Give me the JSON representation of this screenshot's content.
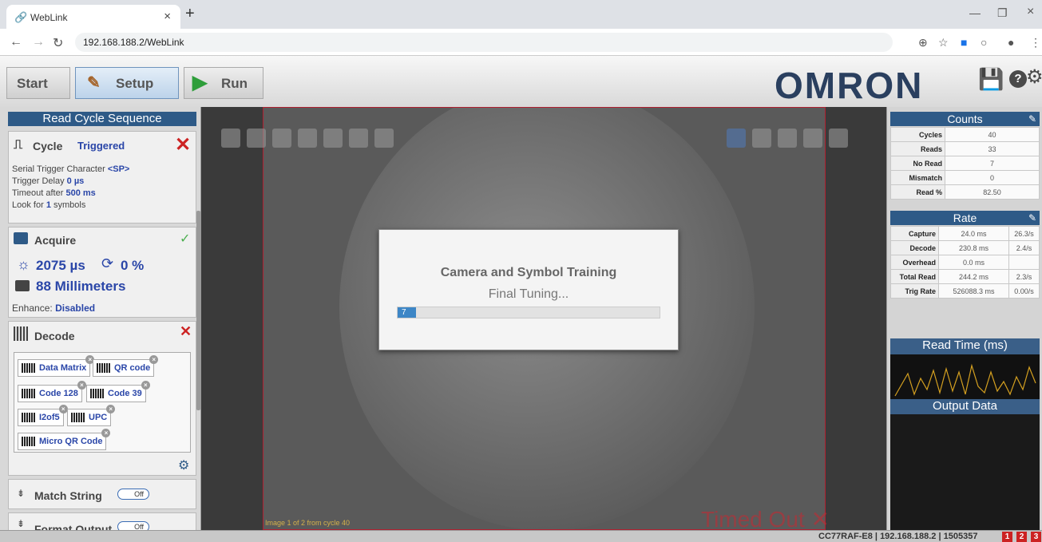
{
  "browser": {
    "tab_title": "WebLink",
    "url": "192.168.188.2/WebLink"
  },
  "app": {
    "steps": [
      "Start",
      "Setup",
      "Run"
    ],
    "logo": "OMRON"
  },
  "left_panel": {
    "title": "Read Cycle Sequence",
    "cycle": {
      "label": "Cycle",
      "mode": "Triggered",
      "lines": [
        {
          "pre": "Serial Trigger Character ",
          "val": "<SP>",
          "post": ""
        },
        {
          "pre": "Trigger Delay ",
          "val": "0 µs",
          "post": ""
        },
        {
          "pre": "Timeout after ",
          "val": "500 ms",
          "post": ""
        },
        {
          "pre": "Look for ",
          "val": "1",
          "post": " symbols"
        }
      ]
    },
    "acquire": {
      "label": "Acquire",
      "exposure": "2075 µs",
      "gain": "0 %",
      "distance": "88 Millimeters",
      "enhance_label": "Enhance:",
      "enhance_value": "Disabled"
    },
    "decode": {
      "label": "Decode",
      "symbologies": [
        "Data Matrix",
        "QR code",
        "Code 128",
        "Code 39",
        "I2of5",
        "UPC",
        "Micro QR Code"
      ]
    },
    "match_string": {
      "label": "Match String",
      "toggle": "Off"
    },
    "format_output": {
      "label": "Format Output",
      "toggle": "Off"
    }
  },
  "center": {
    "modal_title": "Camera and Symbol Training",
    "modal_status": "Final Tuning...",
    "progress_value": "7",
    "progress_fraction": 0.07,
    "image_caption": "Image 1 of 2 from cycle 40",
    "timed_out": "Timed Out"
  },
  "right_panel": {
    "counts_title": "Counts",
    "counts": [
      {
        "k": "Cycles",
        "v": "40"
      },
      {
        "k": "Reads",
        "v": "33"
      },
      {
        "k": "No Read",
        "v": "7"
      },
      {
        "k": "Mismatch",
        "v": "0"
      },
      {
        "k": "Read %",
        "v": "82.50"
      }
    ],
    "rate_title": "Rate",
    "rate": [
      {
        "k": "Capture",
        "v": "24.0 ms",
        "r": "26.3/s"
      },
      {
        "k": "Decode",
        "v": "230.8 ms",
        "r": "2.4/s"
      },
      {
        "k": "Overhead",
        "v": "0.0 ms",
        "r": ""
      },
      {
        "k": "Total Read",
        "v": "244.2 ms",
        "r": "2.3/s"
      },
      {
        "k": "Trig Rate",
        "v": "526088.3 ms",
        "r": "0.00/s"
      }
    ],
    "read_time_title": "Read Time (ms)",
    "output_title": "Output Data"
  },
  "status_bar": {
    "device": "CC77RAF-E8",
    "ip": "192.168.188.2",
    "serial": "1505357",
    "indicators": [
      "1",
      "2",
      "3"
    ]
  },
  "colors": {
    "header_blue": "#2e5a87",
    "accent_blue": "#2a46a8",
    "alert_red": "#cc2222",
    "run_green": "#2e9e3a"
  }
}
